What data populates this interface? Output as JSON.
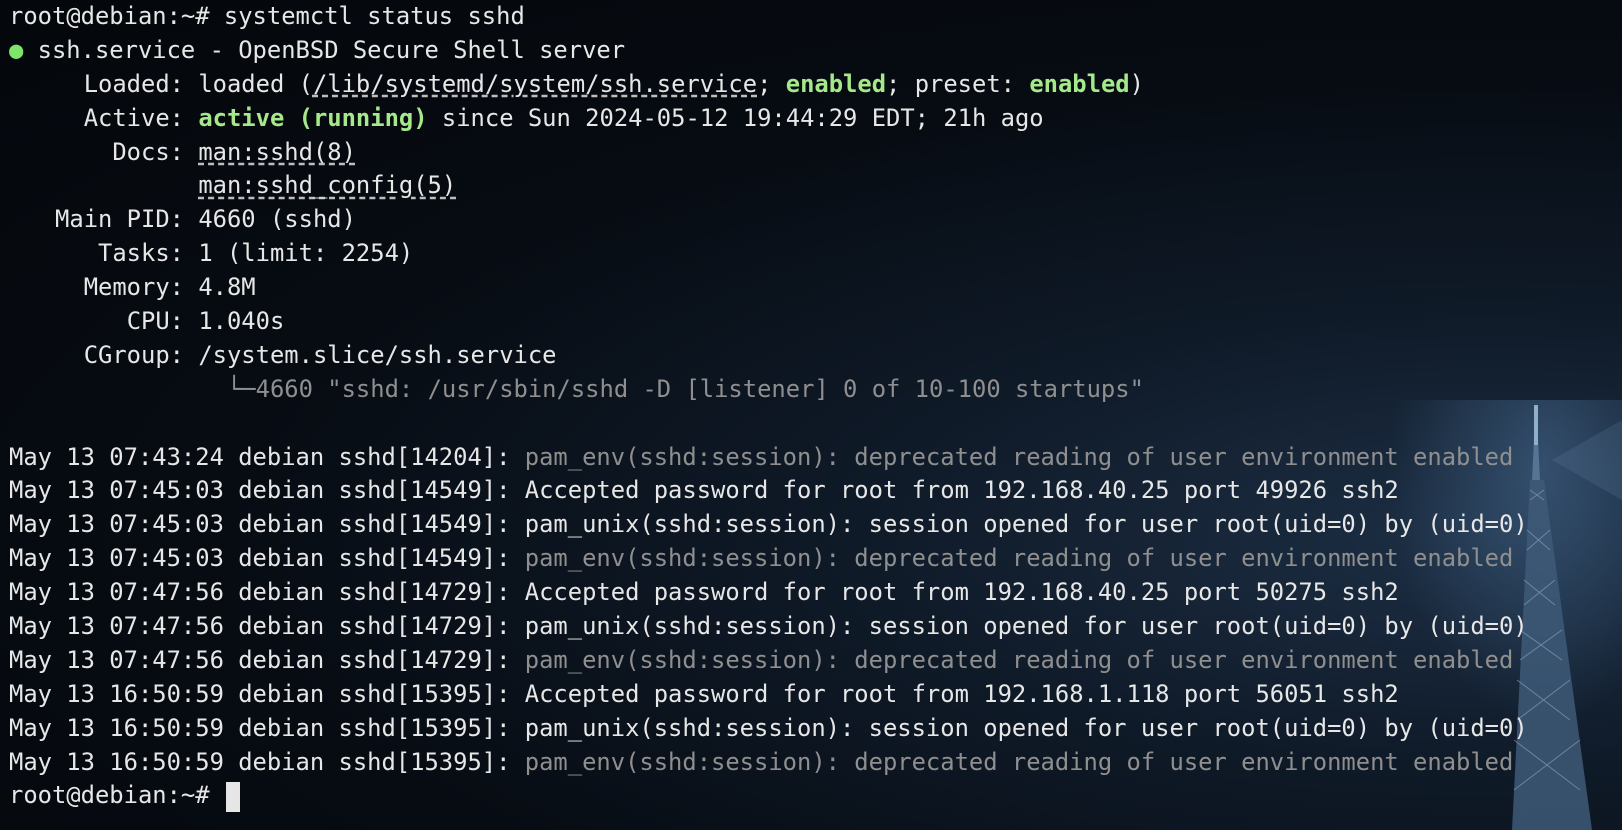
{
  "prompt": "root@debian:~# ",
  "command": "systemctl status sshd",
  "service": {
    "dot": "●",
    "title": "ssh.service - OpenBSD Secure Shell server",
    "loaded_label": "Loaded:",
    "loaded_prefix": "loaded (",
    "loaded_path": "/lib/systemd/system/ssh.service",
    "loaded_sep1": "; ",
    "loaded_enabled": "enabled",
    "loaded_sep2": "; preset: ",
    "loaded_preset": "enabled",
    "loaded_suffix": ")",
    "active_label": "Active:",
    "active_state": "active (running)",
    "active_since": " since Sun 2024-05-12 19:44:29 EDT; 21h ago",
    "docs_label": "Docs:",
    "docs": [
      "man:sshd(8)",
      "man:sshd_config(5)"
    ],
    "pid_label": "Main PID:",
    "pid_value": "4660 (sshd)",
    "tasks_label": "Tasks:",
    "tasks_value": "1 (limit: 2254)",
    "memory_label": "Memory:",
    "memory_value": "4.8M",
    "cpu_label": "CPU:",
    "cpu_value": "1.040s",
    "cgroup_label": "CGroup:",
    "cgroup_value": "/system.slice/ssh.service",
    "cgroup_tree": "└─",
    "cgroup_proc": "4660 \"sshd: /usr/sbin/sshd -D [listener] 0 of 10-100 startups\""
  },
  "logs": [
    {
      "prefix": "May 13 07:43:24 debian sshd[14204]: ",
      "msg": "pam_env(sshd:session): deprecated reading of user environment enabled",
      "dim": true
    },
    {
      "prefix": "May 13 07:45:03 debian sshd[14549]: ",
      "msg": "Accepted password for root from 192.168.40.25 port 49926 ssh2",
      "dim": false
    },
    {
      "prefix": "May 13 07:45:03 debian sshd[14549]: ",
      "msg": "pam_unix(sshd:session): session opened for user root(uid=0) by (uid=0)",
      "dim": false
    },
    {
      "prefix": "May 13 07:45:03 debian sshd[14549]: ",
      "msg": "pam_env(sshd:session): deprecated reading of user environment enabled",
      "dim": true
    },
    {
      "prefix": "May 13 07:47:56 debian sshd[14729]: ",
      "msg": "Accepted password for root from 192.168.40.25 port 50275 ssh2",
      "dim": false
    },
    {
      "prefix": "May 13 07:47:56 debian sshd[14729]: ",
      "msg": "pam_unix(sshd:session): session opened for user root(uid=0) by (uid=0)",
      "dim": false
    },
    {
      "prefix": "May 13 07:47:56 debian sshd[14729]: ",
      "msg": "pam_env(sshd:session): deprecated reading of user environment enabled",
      "dim": true
    },
    {
      "prefix": "May 13 16:50:59 debian sshd[15395]: ",
      "msg": "Accepted password for root from 192.168.1.118 port 56051 ssh2",
      "dim": false
    },
    {
      "prefix": "May 13 16:50:59 debian sshd[15395]: ",
      "msg": "pam_unix(sshd:session): session opened for user root(uid=0) by (uid=0)",
      "dim": false
    },
    {
      "prefix": "May 13 16:50:59 debian sshd[15395]: ",
      "msg": "pam_env(sshd:session): deprecated reading of user environment enabled",
      "dim": true
    }
  ],
  "final_prompt": "root@debian:~# "
}
